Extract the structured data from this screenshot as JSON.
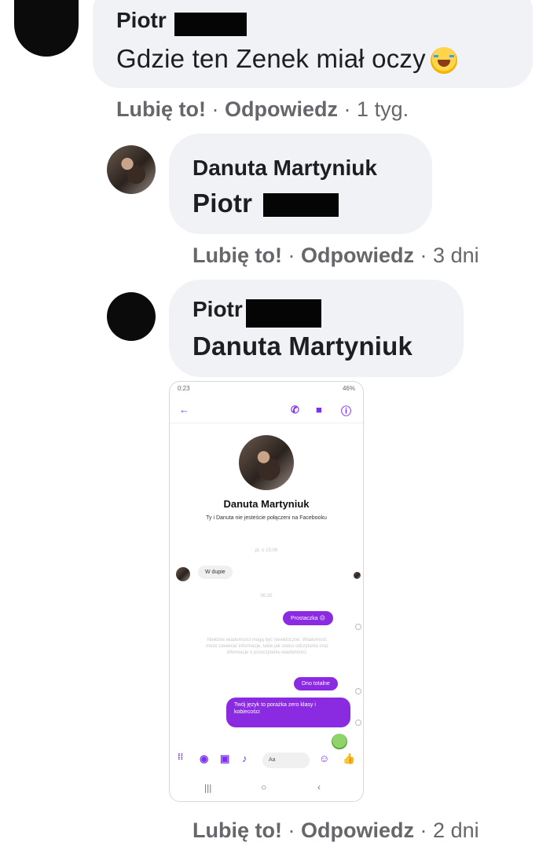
{
  "comments": [
    {
      "author": "Piotr",
      "text": "Gdzie ten Zenek miał oczy",
      "like": "Lubię to!",
      "reply": "Odpowiedz",
      "sep": "·",
      "time": "1 tyg."
    },
    {
      "author": "Danuta Martyniuk",
      "text": "Piotr",
      "like": "Lubię to!",
      "reply": "Odpowiedz",
      "sep": "·",
      "time": "3 dni"
    },
    {
      "author": "Piotr",
      "text": "Danuta Martyniuk",
      "like": "Lubię to!",
      "reply": "Odpowiedz",
      "sep": "·",
      "time": "2 dni"
    }
  ],
  "screenshot": {
    "status_time": "0:23",
    "status_right": "46%",
    "contact_name": "Danuta Martyniuk",
    "subtitle": "Ty i Danuta nie jesteście połączeni na Facebooku",
    "faint_time1": "pt. o 15:06",
    "incoming": "W dupie",
    "faint_time2": "00:20",
    "out1": "Prostaczka",
    "notice": "Niektóre wiadomości mogą być niewidoczne. Wiadomość może zawierać informacje, takie jak status odczytania oraz informacje o przeczytaniu wiadomości.",
    "out2": "Dno totalne",
    "out3": "Twój język to porażka zero klasy i kobiecości",
    "input_placeholder": "Aa",
    "accent": "#8a2be2"
  }
}
